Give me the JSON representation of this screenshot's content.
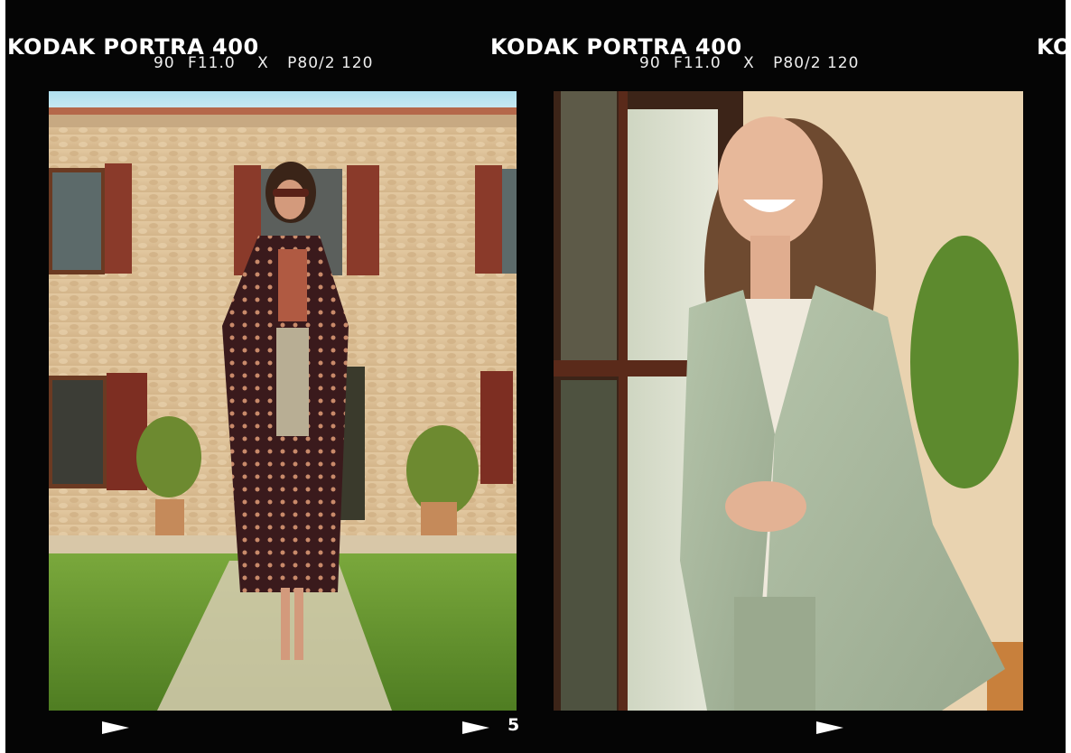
{
  "film": {
    "brand": "KODAK PORTRA 400",
    "iso": "90",
    "aperture": "F11.0",
    "separator": "X",
    "code": "P80/2 120",
    "brand_partial": "KO"
  },
  "frames": [
    {
      "id": "frame-1",
      "subject": "woman-in-patterned-kimono"
    },
    {
      "id": "frame-2",
      "subject": "woman-in-sage-blazer"
    }
  ],
  "markers": {
    "frame_number": "5"
  }
}
